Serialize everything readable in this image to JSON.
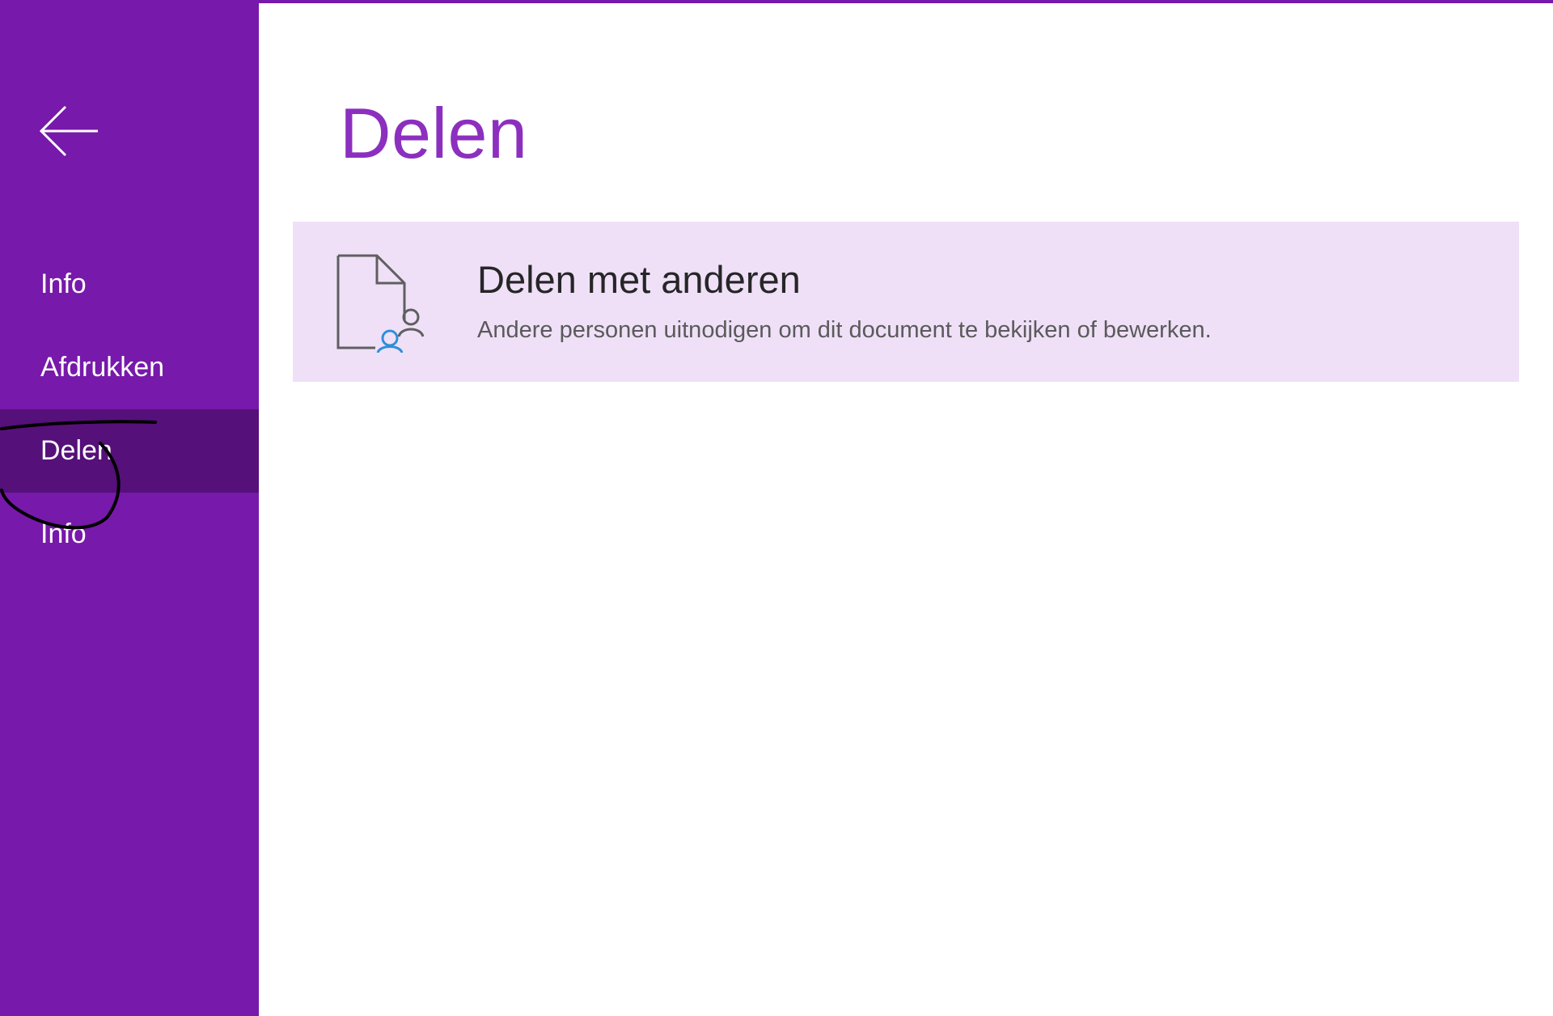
{
  "window": {
    "accent_color": "#7719aa",
    "selected_color": "#56107a",
    "card_background": "#efe0f8"
  },
  "sidebar": {
    "back_icon": "back-arrow-icon",
    "items": [
      {
        "label": "Info",
        "active": false
      },
      {
        "label": "Afdrukken",
        "active": false
      },
      {
        "label": "Delen",
        "active": true
      },
      {
        "label": "Info",
        "active": false
      }
    ]
  },
  "main": {
    "title": "Delen",
    "share_card": {
      "icon": "share-document-icon",
      "title": "Delen met anderen",
      "description": "Andere personen uitnodigen om dit document te bekijken of bewerken."
    }
  }
}
